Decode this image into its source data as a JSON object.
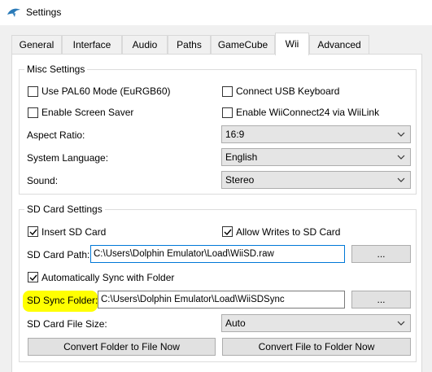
{
  "window": {
    "title": "Settings"
  },
  "tabs": [
    {
      "label": "General"
    },
    {
      "label": "Interface"
    },
    {
      "label": "Audio"
    },
    {
      "label": "Paths"
    },
    {
      "label": "GameCube"
    },
    {
      "label": "Wii",
      "active": true
    },
    {
      "label": "Advanced"
    }
  ],
  "misc": {
    "title": "Misc Settings",
    "pal60": {
      "label": "Use PAL60 Mode (EuRGB60)",
      "checked": false
    },
    "usb_keyboard": {
      "label": "Connect USB Keyboard",
      "checked": false
    },
    "screen_saver": {
      "label": "Enable Screen Saver",
      "checked": false
    },
    "wiiconnect": {
      "label": "Enable WiiConnect24 via WiiLink",
      "checked": false
    },
    "aspect_ratio": {
      "label": "Aspect Ratio:",
      "value": "16:9"
    },
    "system_language": {
      "label": "System Language:",
      "value": "English"
    },
    "sound": {
      "label": "Sound:",
      "value": "Stereo"
    }
  },
  "sd": {
    "title": "SD Card Settings",
    "insert": {
      "label": "Insert SD Card",
      "checked": true
    },
    "allow_writes": {
      "label": "Allow Writes to SD Card",
      "checked": true
    },
    "card_path": {
      "label": "SD Card Path:",
      "value": "C:\\Users\\Dolphin Emulator\\Load\\WiiSD.raw",
      "browse": "..."
    },
    "auto_sync": {
      "label": "Automatically Sync with Folder",
      "checked": true
    },
    "sync_folder": {
      "label": "SD Sync Folder:",
      "value": "C:\\Users\\Dolphin Emulator\\Load\\WiiSDSync",
      "browse": "..."
    },
    "file_size": {
      "label": "SD Card File Size:",
      "value": "Auto"
    },
    "convert_to_file": "Convert Folder to File Now",
    "convert_to_folder": "Convert File to Folder Now"
  },
  "colors": {
    "highlight": "#ffff00",
    "focus": "#0078d7",
    "accent": "#2a7ab8"
  }
}
